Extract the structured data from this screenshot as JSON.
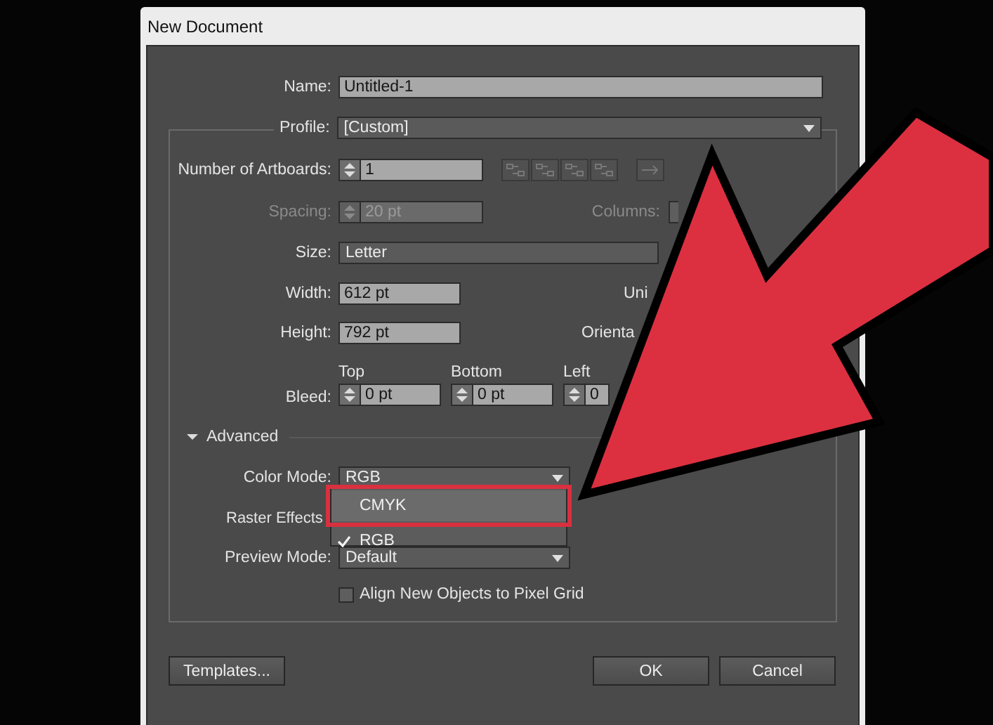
{
  "window": {
    "title": "New Document"
  },
  "name": {
    "label": "Name:",
    "value": "Untitled-1"
  },
  "profile": {
    "label": "Profile:",
    "value": "[Custom]"
  },
  "artboards": {
    "label": "Number of Artboards:",
    "value": "1"
  },
  "spacing": {
    "label": "Spacing:",
    "value": "20 pt",
    "disabled": true
  },
  "columns": {
    "label": "Columns:",
    "disabled": true
  },
  "size": {
    "label": "Size:",
    "value": "Letter"
  },
  "width": {
    "label": "Width:",
    "value": "612 pt"
  },
  "units": {
    "label": "Uni"
  },
  "height": {
    "label": "Height:",
    "value": "792 pt"
  },
  "orientation": {
    "label": "Orienta"
  },
  "bleed": {
    "label": "Bleed:",
    "fields": [
      {
        "label": "Top",
        "value": "0 pt"
      },
      {
        "label": "Bottom",
        "value": "0 pt"
      },
      {
        "label": "Left",
        "value": "0"
      }
    ]
  },
  "advanced": {
    "label": "Advanced",
    "expanded": true
  },
  "color_mode": {
    "label": "Color Mode:",
    "value": "RGB",
    "options": [
      {
        "label": "CMYK",
        "selected": false,
        "annotated": true
      },
      {
        "label": "RGB",
        "selected": true,
        "annotated": false
      }
    ]
  },
  "raster_effects": {
    "label": "Raster Effects"
  },
  "preview_mode": {
    "label": "Preview Mode:",
    "value": "Default"
  },
  "align_pixel_grid": {
    "label": "Align New Objects to Pixel Grid",
    "checked": false
  },
  "buttons": [
    {
      "label": "Templates..."
    },
    {
      "label": "OK"
    },
    {
      "label": "Cancel"
    }
  ]
}
